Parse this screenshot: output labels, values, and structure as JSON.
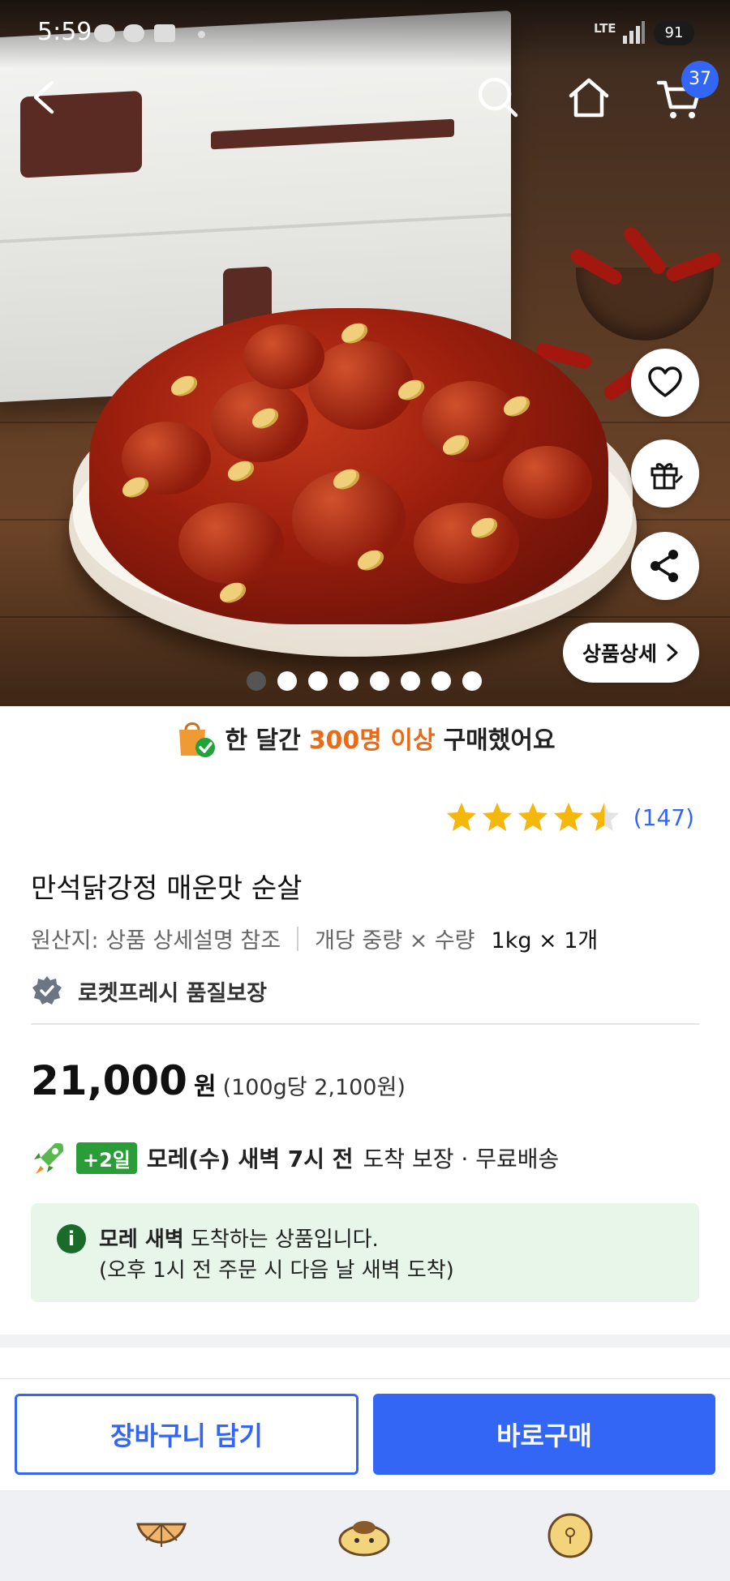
{
  "status_bar": {
    "time": "5:59",
    "network": "LTE",
    "battery": "91"
  },
  "top_nav": {
    "cart_count": "37",
    "icons": [
      "back-arrow-icon",
      "search-icon",
      "home-icon",
      "cart-icon"
    ]
  },
  "hero": {
    "carousel_total": 8,
    "carousel_active": 1,
    "detail_button_label": "상품상세",
    "side_actions": [
      "heart-icon",
      "gift-icon",
      "share-icon"
    ]
  },
  "purchase_banner": {
    "prefix": "한 달간",
    "highlight": "300명 이상",
    "suffix": "구매했어요"
  },
  "rating": {
    "stars": 4.5,
    "count": "(147)"
  },
  "product": {
    "title": "만석닭강정 매운맛 순살",
    "origin_label": "원산지: 상품 상세설명 참조",
    "weight_label": "개당 중량 × 수량",
    "weight_value": "1kg × 1개",
    "quality_label": "로켓프레시 품질보장"
  },
  "price": {
    "amount": "21,000",
    "unit": "원",
    "per_unit": "(100g당 2,100원)"
  },
  "delivery": {
    "badge": "+2일",
    "arrival_bold": "모레(수) 새벽 7시 전",
    "arrival_rest": "도착 보장 · 무료배송"
  },
  "notice": {
    "icon": "i",
    "line1_bold": "모레 새벽",
    "line1_rest": "도착하는 상품입니다.",
    "line2": "(오후 1시 전 주문 시 다음 날 새벽 도착)"
  },
  "actions": {
    "add_to_cart": "장바구니 담기",
    "buy_now": "바로구매"
  },
  "colors": {
    "accent_blue": "#3466f6",
    "highlight_orange": "#ea6a16",
    "star_yellow": "#f5b70a",
    "delivery_green": "#2a9d38",
    "notice_bg": "#e7f6e9"
  }
}
